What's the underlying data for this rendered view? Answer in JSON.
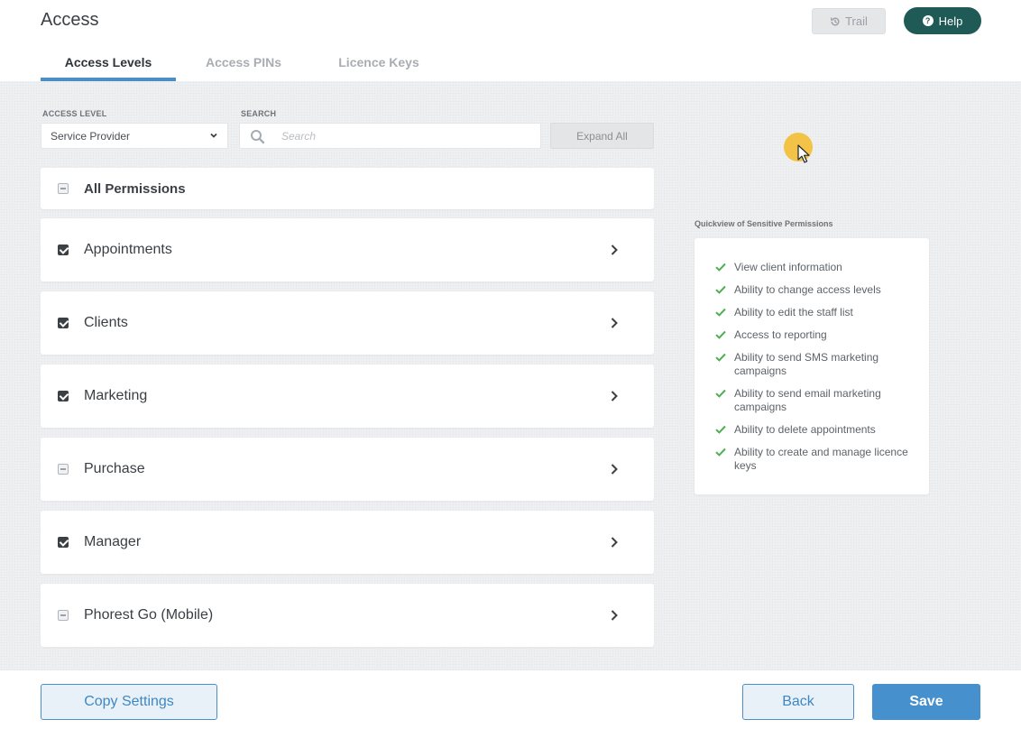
{
  "header": {
    "title": "Access",
    "trail_label": "Trail",
    "help_label": "Help"
  },
  "tabs": [
    {
      "label": "Access Levels",
      "active": true
    },
    {
      "label": "Access PINs",
      "active": false
    },
    {
      "label": "Licence Keys",
      "active": false
    }
  ],
  "filters": {
    "access_level_label": "ACCESS LEVEL",
    "access_level_value": "Service Provider",
    "search_label": "SEARCH",
    "search_placeholder": "Search",
    "expand_all_label": "Expand All"
  },
  "permissions": {
    "all": {
      "label": "All Permissions",
      "state": "partial"
    },
    "groups": [
      {
        "label": "Appointments",
        "state": "checked"
      },
      {
        "label": "Clients",
        "state": "checked"
      },
      {
        "label": "Marketing",
        "state": "checked"
      },
      {
        "label": "Purchase",
        "state": "partial"
      },
      {
        "label": "Manager",
        "state": "checked"
      },
      {
        "label": "Phorest Go (Mobile)",
        "state": "partial"
      }
    ]
  },
  "quickview": {
    "title": "Quickview of Sensitive Permissions",
    "items": [
      "View client information",
      "Ability to change access levels",
      "Ability to edit the staff list",
      "Access to reporting",
      "Ability to send SMS marketing campaigns",
      "Ability to send email marketing campaigns",
      "Ability to delete appointments",
      "Ability to create and manage licence keys"
    ]
  },
  "footer": {
    "copy_settings_label": "Copy Settings",
    "back_label": "Back",
    "save_label": "Save"
  },
  "colors": {
    "accent": "#4590cd",
    "help_button": "#1f5a57",
    "check_green": "#4caf50"
  }
}
